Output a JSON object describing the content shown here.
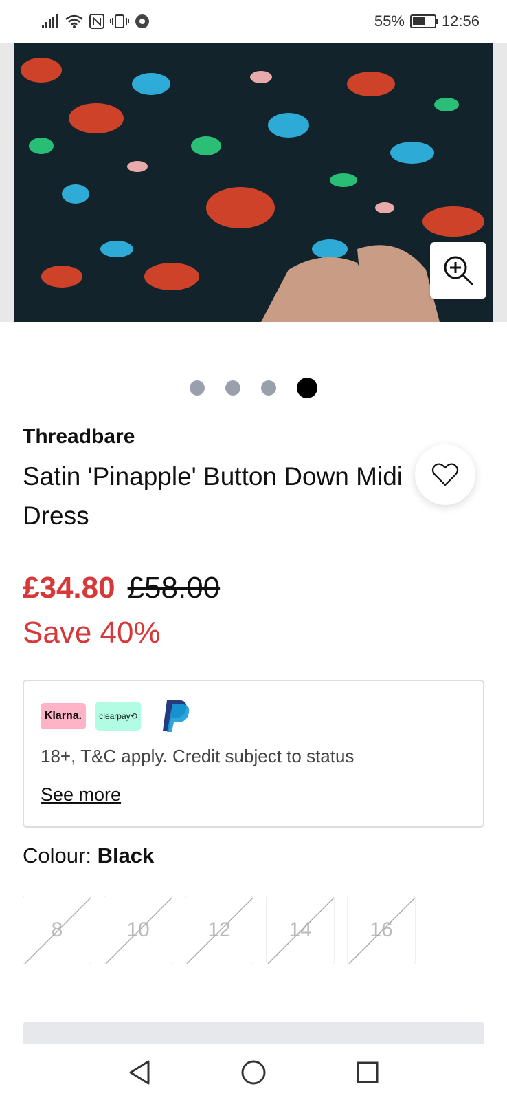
{
  "status_bar": {
    "battery_percent": "55%",
    "time": "12:56"
  },
  "product": {
    "brand": "Threadbare",
    "title": "Satin 'Pinapple' Button Down Midi Dress",
    "price_now": "£34.80",
    "price_was": "£58.00",
    "save_text": "Save 40%",
    "carousel": {
      "total": 4,
      "active_index": 3
    }
  },
  "payment": {
    "klarna_label": "Klarna.",
    "clearpay_label": "clearpay⟲",
    "terms": "18+, T&C apply. Credit subject to status",
    "see_more": "See more"
  },
  "colour": {
    "label": "Colour:",
    "value": "Black"
  },
  "sizes": [
    "8",
    "10",
    "12",
    "14",
    "16"
  ],
  "icons": {
    "zoom": "zoom-in-icon",
    "wishlist": "heart-icon",
    "back": "back-triangle-icon",
    "home": "home-circle-icon",
    "recents": "recents-square-icon"
  },
  "colors": {
    "sale_red": "#d6393a",
    "dot_inactive": "#9aa0ab",
    "klarna_pink": "#ffb3c7",
    "clearpay_mint": "#b2fce4"
  }
}
